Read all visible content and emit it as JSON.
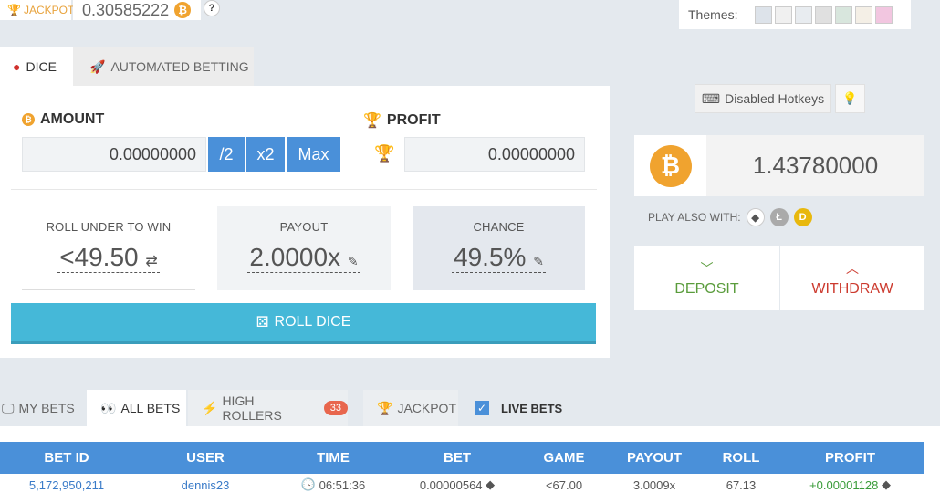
{
  "top": {
    "jackpot_label": "JACKPOT",
    "jackpot_value": "0.30585222",
    "help": "?",
    "themes_label": "Themes:",
    "theme_swatches": [
      "#dde3ea",
      "#f0f0f0",
      "#e8ecf0",
      "#e0e0e0",
      "#d8e6dd",
      "#f4efe6",
      "#f2c6e0"
    ]
  },
  "game_tabs": {
    "dice": "DICE",
    "automated": "AUTOMATED BETTING"
  },
  "bet_form": {
    "amount_title": "AMOUNT",
    "amount_value": "0.00000000",
    "half_btn": "/2",
    "double_btn": "x2",
    "max_btn": "Max",
    "profit_title": "PROFIT",
    "profit_value": "0.00000000"
  },
  "stats": {
    "roll_label": "ROLL UNDER TO WIN",
    "roll_value": "<49.50",
    "payout_label": "PAYOUT",
    "payout_value": "2.0000x",
    "chance_label": "CHANCE",
    "chance_value": "49.5%"
  },
  "roll_button": "ROLL DICE",
  "side": {
    "hotkeys": "Disabled Hotkeys",
    "balance": "1.43780000",
    "play_also": "PLAY ALSO WITH:",
    "deposit": "DEPOSIT",
    "withdraw": "WITHDRAW"
  },
  "bets_tabs": {
    "my_bets": "MY BETS",
    "all_bets": "ALL BETS",
    "high_rollers": "HIGH ROLLERS",
    "high_rollers_count": "33",
    "jackpot": "JACKPOT",
    "live_bets": "LIVE BETS"
  },
  "table": {
    "headers": [
      "BET ID",
      "USER",
      "TIME",
      "BET",
      "GAME",
      "PAYOUT",
      "ROLL",
      "PROFIT"
    ],
    "rows": [
      [
        "5,172,950,211",
        "dennis23",
        "06:51:36",
        "0.00000564",
        "<67.00",
        "3.0009x",
        "67.13",
        "+0.00001128"
      ]
    ]
  },
  "colors": {
    "accent_blue": "#4a90d9",
    "roll_button": "#45b8d8",
    "bitcoin": "#f0a32f",
    "deposit_green": "#5a9c3c",
    "withdraw_red": "#cc3a2e"
  }
}
